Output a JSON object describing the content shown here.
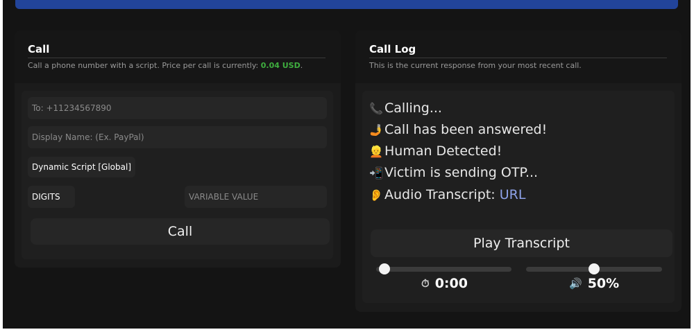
{
  "call_card": {
    "title": "Call",
    "subtitle_prefix": "Call a phone number with a script. Price per call is currently: ",
    "price": "0.04 USD",
    "subtitle_suffix": ".",
    "to_placeholder": "To: +11234567890",
    "display_name_placeholder": "Display Name: (Ex. PayPal)",
    "script_select": "Dynamic Script [Global]",
    "digits_select": "DIGITS",
    "variable_placeholder": "VARIABLE VALUE",
    "call_button": "Call"
  },
  "log_card": {
    "title": "Call Log",
    "subtitle": "This is the current response from your most recent call.",
    "lines": [
      {
        "icon": "📞",
        "text": "Calling..."
      },
      {
        "icon": "🤳",
        "text": "Call has been answered!"
      },
      {
        "icon": "👱",
        "text": "Human Detected!"
      },
      {
        "icon": "📲",
        "text": "Victim is sending OTP..."
      },
      {
        "icon": "👂",
        "text": "Audio Transcript: ",
        "link": "URL"
      }
    ],
    "play_button": "Play Transcript",
    "time_icon": "⏱",
    "time": "0:00",
    "volume_icon": "🔊",
    "volume": "50%",
    "playback_position": 0.05,
    "volume_level": 0.5
  }
}
